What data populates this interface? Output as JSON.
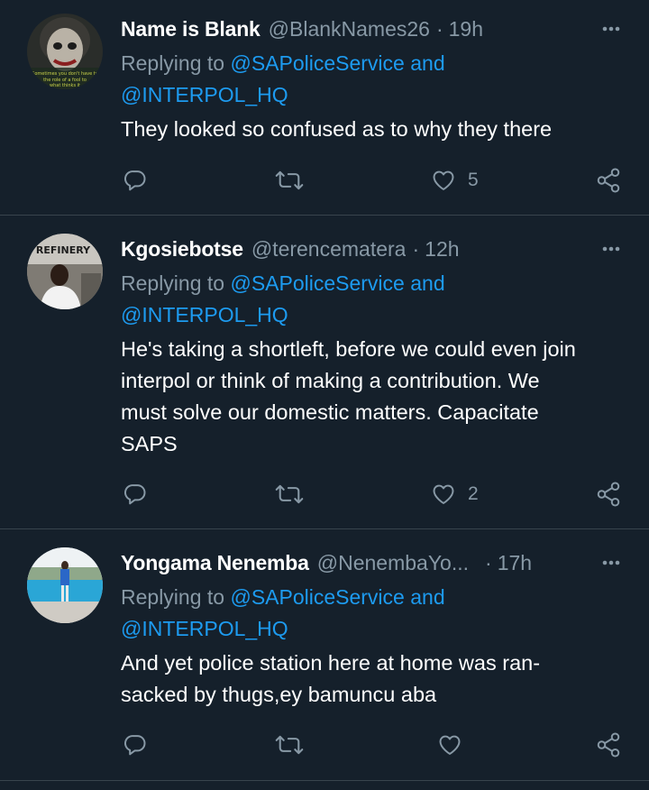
{
  "tweets": [
    {
      "name": "Name is Blank",
      "handle": "@BlankNames26",
      "time": "19h",
      "replying_prefix": "Replying to",
      "mention1": "@SAPoliceService",
      "conj": "and",
      "mention2": "@INTERPOL_HQ",
      "text": [
        "They looked so confused as to why they there"
      ],
      "likes": "5",
      "avatar_caption": "Sometimes you don't have to the role of a fool to what thinks it"
    },
    {
      "name": "Kgosiebotse",
      "handle": "@terencematera",
      "time": "12h",
      "replying_prefix": "Replying to",
      "mention1": "@SAPoliceService",
      "conj": "and",
      "mention2": "@INTERPOL_HQ",
      "text": [
        "He's taking a shortleft, before we could even join",
        "interpol or think of making a contribution. We",
        "must solve our domestic matters. Capacitate",
        "SAPS"
      ],
      "likes": "2",
      "avatar_caption": "REFINERY"
    },
    {
      "name": "Yongama Nenemba",
      "handle": "@NenembaYo...",
      "time": "17h",
      "replying_prefix": "Replying to",
      "mention1": "@SAPoliceService",
      "conj": "and",
      "mention2": "@INTERPOL_HQ",
      "text": [
        "And yet police station here at home was ran-",
        "sacked by thugs,ey bamuncu aba"
      ],
      "likes": ""
    }
  ],
  "icons": {
    "reply": "reply-icon",
    "retweet": "retweet-icon",
    "like": "heart-icon",
    "share": "share-icon",
    "more": "more-icon"
  },
  "colors": {
    "background": "#15202b",
    "secondary_text": "#8899a6",
    "link": "#1d9bf0",
    "divider": "#38444d"
  }
}
